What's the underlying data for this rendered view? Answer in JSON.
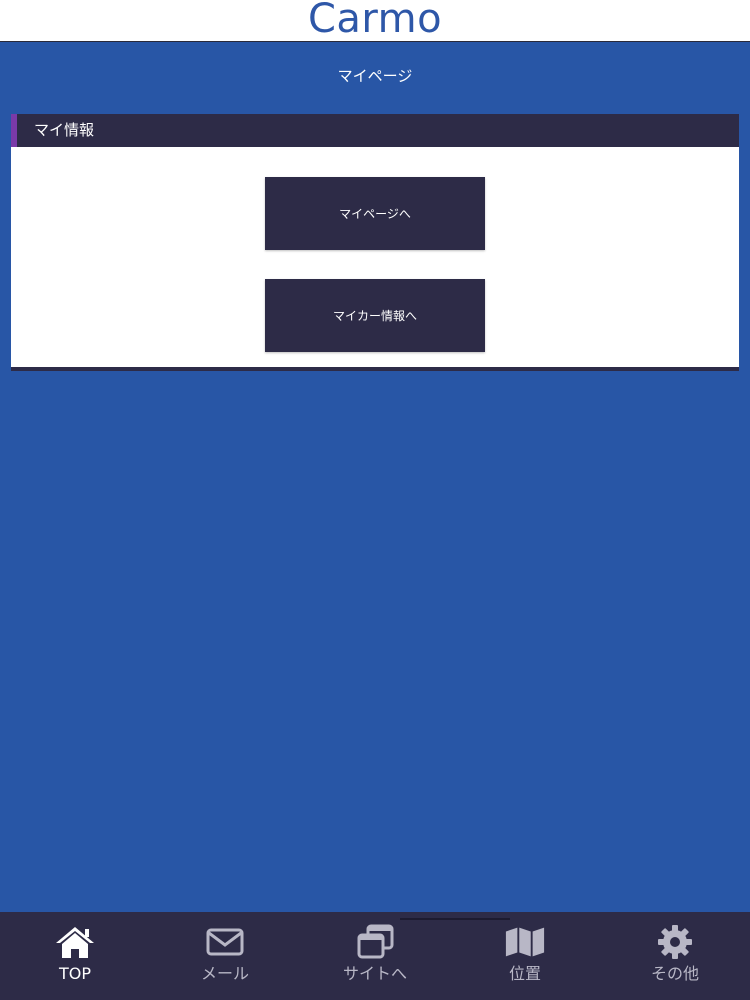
{
  "app": {
    "title": "Carmo",
    "brand_color": "#2e57a8",
    "background_color": "#2856a6"
  },
  "page": {
    "title": "マイページ"
  },
  "section": {
    "title": "マイ情報",
    "accent_color": "#7a3aa8",
    "buttons": [
      {
        "label": "マイページへ"
      },
      {
        "label": "マイカー情報へ"
      }
    ]
  },
  "tabbar": {
    "items": [
      {
        "label": "TOP",
        "icon": "home-icon",
        "active": true
      },
      {
        "label": "メール",
        "icon": "mail-icon",
        "active": false
      },
      {
        "label": "サイトへ",
        "icon": "windows-icon",
        "active": false
      },
      {
        "label": "位置",
        "icon": "map-icon",
        "active": false
      },
      {
        "label": "その他",
        "icon": "gear-icon",
        "active": false
      }
    ]
  }
}
